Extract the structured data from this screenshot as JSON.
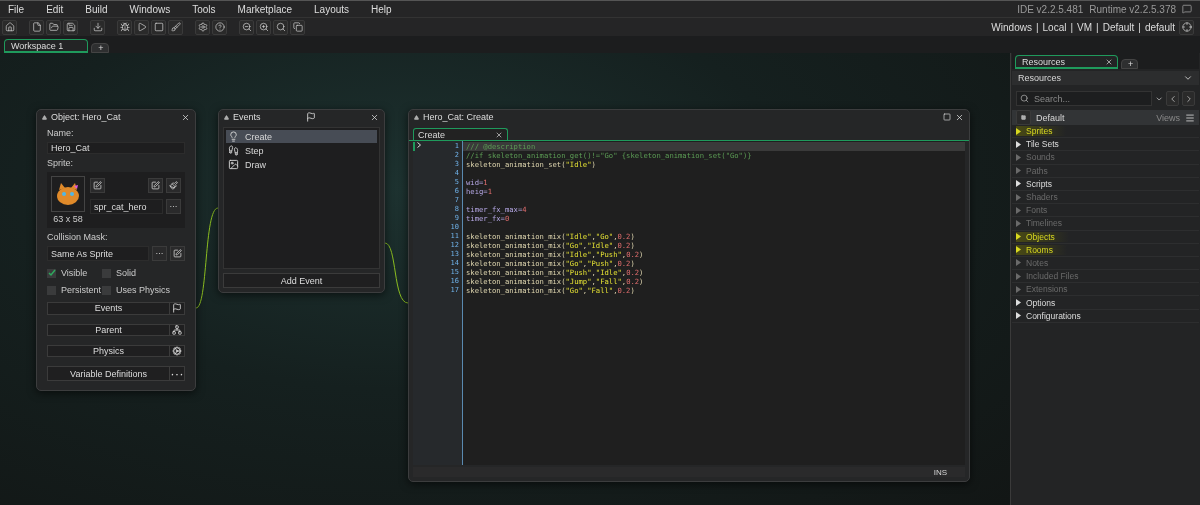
{
  "menu": [
    "File",
    "Edit",
    "Build",
    "Windows",
    "Tools",
    "Marketplace",
    "Layouts",
    "Help"
  ],
  "versions": {
    "ide": "IDE v2.2.5.481",
    "runtime": "Runtime v2.2.5.378"
  },
  "targets": [
    "Windows",
    "|",
    "Local",
    "|",
    "VM",
    "|",
    "Default",
    "|",
    "default"
  ],
  "workspace_tabs": [
    {
      "label": "Workspace 1",
      "selected": true
    },
    {
      "label": "+",
      "selected": false
    }
  ],
  "object_window": {
    "title": "Object: Hero_Cat",
    "name_label": "Name:",
    "name": "Hero_Cat",
    "sprite_label": "Sprite:",
    "sprite_size": "63 x 58",
    "sprite_name": "spr_cat_hero",
    "more": "···",
    "mask_label": "Collision Mask:",
    "mask": "Same As Sprite",
    "checkboxes": [
      {
        "label": "Visible",
        "checked": true
      },
      {
        "label": "Solid",
        "checked": false
      },
      {
        "label": "Persistent",
        "checked": false
      },
      {
        "label": "Uses Physics",
        "checked": false
      }
    ],
    "buttons": [
      {
        "label": "Events",
        "kind": "flag"
      },
      {
        "label": "Parent",
        "kind": "tree"
      },
      {
        "label": "Physics",
        "kind": "gear"
      },
      {
        "label": "Variable Definitions",
        "kind": "more"
      }
    ]
  },
  "events_window": {
    "title": "Events",
    "events": [
      {
        "label": "Create",
        "kind": "create",
        "selected": true
      },
      {
        "label": "Step",
        "kind": "step",
        "selected": false
      },
      {
        "label": "Draw",
        "kind": "draw",
        "selected": false
      }
    ],
    "add_button": "Add Event"
  },
  "code_window": {
    "title": "Hero_Cat: Create",
    "tab": "Create",
    "status": "INS",
    "lines": [
      {
        "number": "1",
        "code": "/// @description",
        "current": true
      },
      {
        "number": "2",
        "code": "//if skeleton_animation_get()!=\"Go\" {skeleton_animation_set(\"Go\")}",
        "current": false
      },
      {
        "number": "3",
        "code": "skeleton_animation_set(\"Idle\")",
        "current": false
      },
      {
        "number": "4",
        "current": false
      },
      {
        "number": "5",
        "code": "wid=1",
        "current": false
      },
      {
        "number": "6",
        "code": "heig=1",
        "current": false
      },
      {
        "number": "7",
        "current": false
      },
      {
        "number": "8",
        "code": "timer_fx_max=4",
        "current": false
      },
      {
        "number": "9",
        "code": "timer_fx=0",
        "current": false
      },
      {
        "number": "10",
        "current": false
      },
      {
        "number": "11",
        "code": "skeleton_animation_mix(\"Idle\",\"Go\",0.2)",
        "current": false
      },
      {
        "number": "12",
        "code": "skeleton_animation_mix(\"Go\",\"Idle\",0.2)",
        "current": false
      },
      {
        "number": "13",
        "code": "skeleton_animation_mix(\"Idle\",\"Push\",0.2)",
        "current": false
      },
      {
        "number": "14",
        "code": "skeleton_animation_mix(\"Go\",\"Push\",0.2)",
        "current": false
      },
      {
        "number": "15",
        "code": "skeleton_animation_mix(\"Push\",\"Idle\",0.2)",
        "current": false
      },
      {
        "number": "16",
        "code": "skeleton_animation_mix(\"Jump\",\"Fall\",0.2)",
        "current": false
      },
      {
        "number": "17",
        "code": "skeleton_animation_mix(\"Go\",\"Fall\",0.2)",
        "current": false
      }
    ]
  },
  "resources": {
    "tabs": [
      {
        "label": "Resources",
        "selected": true
      },
      {
        "label": "+",
        "selected": false
      }
    ],
    "header": "Resources",
    "search": {
      "placeholder": "Search..."
    },
    "group": "Default",
    "views": "Views",
    "items": [
      {
        "label": "Sprites",
        "highlighted": true,
        "empty": false
      },
      {
        "label": "Tile Sets",
        "highlighted": false,
        "empty": false
      },
      {
        "label": "Sounds",
        "highlighted": false,
        "empty": true
      },
      {
        "label": "Paths",
        "highlighted": false,
        "empty": true
      },
      {
        "label": "Scripts",
        "highlighted": false,
        "empty": false
      },
      {
        "label": "Shaders",
        "highlighted": false,
        "empty": true
      },
      {
        "label": "Fonts",
        "highlighted": false,
        "empty": true
      },
      {
        "label": "Timelines",
        "highlighted": false,
        "empty": true
      },
      {
        "label": "Objects",
        "highlighted": true,
        "empty": false
      },
      {
        "label": "Rooms",
        "highlighted": true,
        "empty": false
      },
      {
        "label": "Notes",
        "highlighted": false,
        "empty": true
      },
      {
        "label": "Included Files",
        "highlighted": false,
        "empty": true
      },
      {
        "label": "Extensions",
        "highlighted": false,
        "empty": true
      },
      {
        "label": "Options",
        "highlighted": false,
        "empty": false
      },
      {
        "label": "Configurations",
        "highlighted": false,
        "empty": false
      }
    ]
  }
}
